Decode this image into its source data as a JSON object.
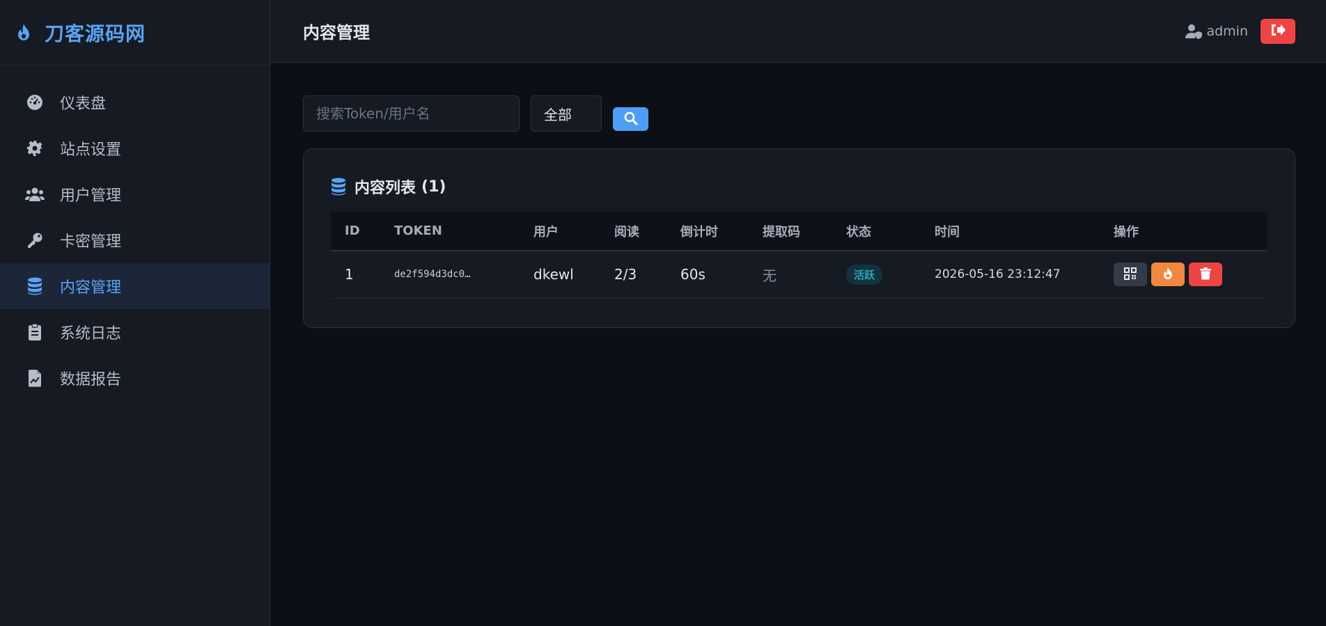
{
  "brand": {
    "title": "刀客源码网"
  },
  "sidebar": {
    "items": [
      {
        "label": "仪表盘",
        "icon": "dashboard-icon",
        "active": false
      },
      {
        "label": "站点设置",
        "icon": "gear-icon",
        "active": false
      },
      {
        "label": "用户管理",
        "icon": "users-icon",
        "active": false
      },
      {
        "label": "卡密管理",
        "icon": "key-icon",
        "active": false
      },
      {
        "label": "内容管理",
        "icon": "database-icon",
        "active": true
      },
      {
        "label": "系统日志",
        "icon": "clipboard-icon",
        "active": false
      },
      {
        "label": "数据报告",
        "icon": "file-chart-icon",
        "active": false
      }
    ]
  },
  "header": {
    "title": "内容管理",
    "username": "admin"
  },
  "filters": {
    "search_placeholder": "搜索Token/用户名",
    "search_value": "",
    "status_selected": "全部"
  },
  "content_list": {
    "title": "内容列表",
    "count": "(1)",
    "columns": [
      "ID",
      "TOKEN",
      "用户",
      "阅读",
      "倒计时",
      "提取码",
      "状态",
      "时间",
      "操作"
    ],
    "rows": [
      {
        "id": "1",
        "token": "de2f594d3dc0…",
        "user": "dkewl",
        "reads": "2/3",
        "countdown": "60s",
        "code": "无",
        "status": "活跃",
        "time": "2026-05-16 23:12:47"
      }
    ]
  },
  "colors": {
    "accent": "#5aa3f5",
    "danger": "#ef4444",
    "warning": "#f0883e",
    "status_active": "#2ea7b8"
  }
}
